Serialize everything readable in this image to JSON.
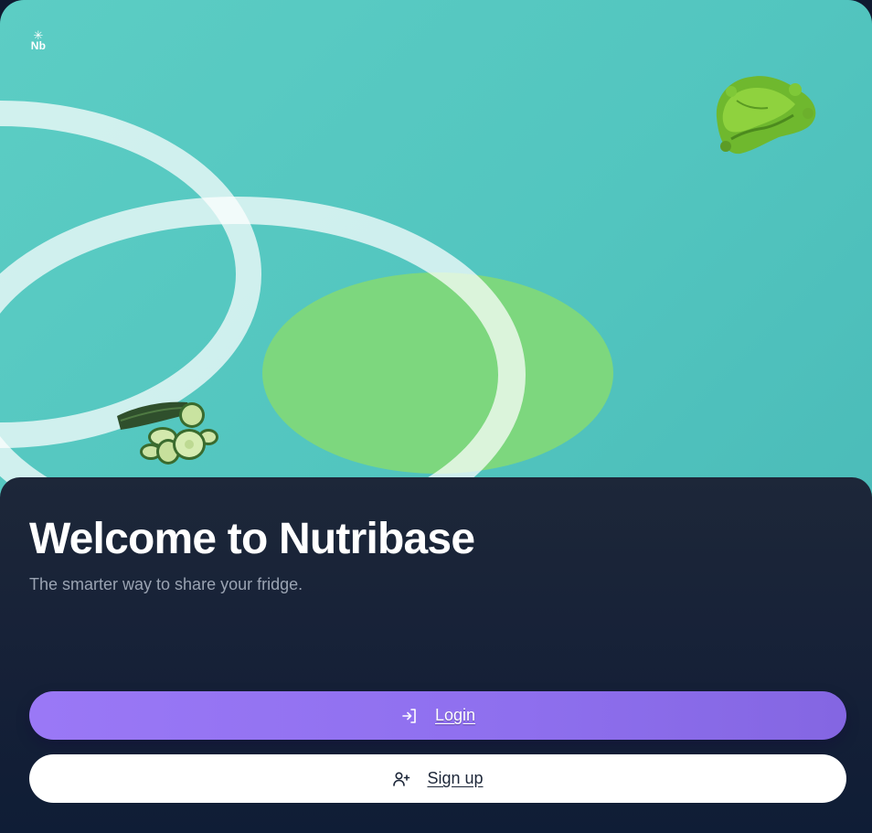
{
  "app": {
    "logo_symbol": "✳",
    "logo_text": "Nb"
  },
  "hero": {
    "decorations": [
      "lettuce-image",
      "cucumber-slices-image"
    ],
    "colors": {
      "background": "#56c8c1",
      "ring": "#ffffff",
      "blob": "#7fd87a"
    }
  },
  "welcome": {
    "title": "Welcome to Nutribase",
    "subtitle": "The smarter way to share your fridge."
  },
  "actions": {
    "login": {
      "label": "Login",
      "icon": "login-icon",
      "color": "#9477f2"
    },
    "signup": {
      "label": "Sign up",
      "icon": "user-plus-icon",
      "color": "#ffffff"
    }
  },
  "theme": {
    "panel_background": "#1b2538",
    "subtitle_color": "#9aa3b2"
  }
}
